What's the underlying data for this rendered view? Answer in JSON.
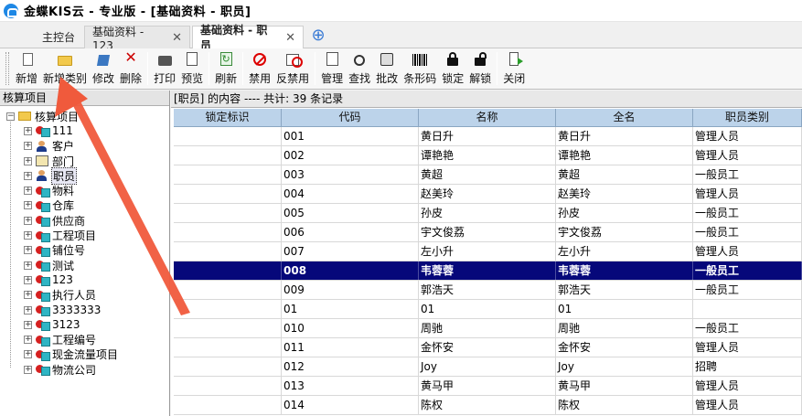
{
  "window": {
    "title": "金蝶KIS云 - 专业版 - [基础资料 - 职员]"
  },
  "tabs": {
    "home": "主控台",
    "tab1": "基础资料 - 123",
    "tab2": "基础资料 - 职员",
    "close_glyph": "✕",
    "add_glyph": "⊕"
  },
  "toolbar": {
    "new": "新增",
    "new_category": "新增类别",
    "modify": "修改",
    "delete": "删除",
    "print": "打印",
    "preview": "预览",
    "refresh": "刷新",
    "disable": "禁用",
    "undisable": "反禁用",
    "manage": "管理",
    "find": "查找",
    "batch_modify": "批改",
    "barcode": "条形码",
    "lock": "锁定",
    "unlock": "解锁",
    "close": "关闭"
  },
  "tree": {
    "header": "核算项目",
    "root": "核算项目",
    "items": [
      "111",
      "客户",
      "部门",
      "职员",
      "物料",
      "仓库",
      "供应商",
      "工程项目",
      "铺位号",
      "测试",
      "123",
      "执行人员",
      "3333333",
      "3123",
      "工程编号",
      "现金流量项目",
      "物流公司"
    ],
    "expand_glyph": "+",
    "collapse_glyph": "−"
  },
  "grid": {
    "header": "[职员] 的内容 ---- 共计: 39 条记录",
    "columns": [
      "锁定标识",
      "代码",
      "名称",
      "全名",
      "职员类别"
    ],
    "rows": [
      [
        "",
        "001",
        "黄日升",
        "黄日升",
        "管理人员"
      ],
      [
        "",
        "002",
        "谭艳艳",
        "谭艳艳",
        "管理人员"
      ],
      [
        "",
        "003",
        "黄超",
        "黄超",
        "一般员工"
      ],
      [
        "",
        "004",
        "赵美玲",
        "赵美玲",
        "管理人员"
      ],
      [
        "",
        "005",
        "孙皮",
        "孙皮",
        "一般员工"
      ],
      [
        "",
        "006",
        "宇文俊荔",
        "宇文俊荔",
        "一般员工"
      ],
      [
        "",
        "007",
        "左小升",
        "左小升",
        "管理人员"
      ],
      [
        "",
        "008",
        "韦蓉蓉",
        "韦蓉蓉",
        "一般员工"
      ],
      [
        "",
        "009",
        "郭浩天",
        "郭浩天",
        "一般员工"
      ],
      [
        "",
        "01",
        "01",
        "01",
        ""
      ],
      [
        "",
        "010",
        "周驰",
        "周驰",
        "一般员工"
      ],
      [
        "",
        "011",
        "金怀安",
        "金怀安",
        "管理人员"
      ],
      [
        "",
        "012",
        "Joy",
        "Joy",
        "招聘"
      ],
      [
        "",
        "013",
        "黄马甲",
        "黄马甲",
        "管理人员"
      ],
      [
        "",
        "014",
        "陈权",
        "陈权",
        "管理人员"
      ]
    ],
    "selected_row": 7
  },
  "colors": {
    "selection": "#06087a",
    "grid_header": "#bcd3ea",
    "annotation_arrow": "#f05a3c"
  }
}
